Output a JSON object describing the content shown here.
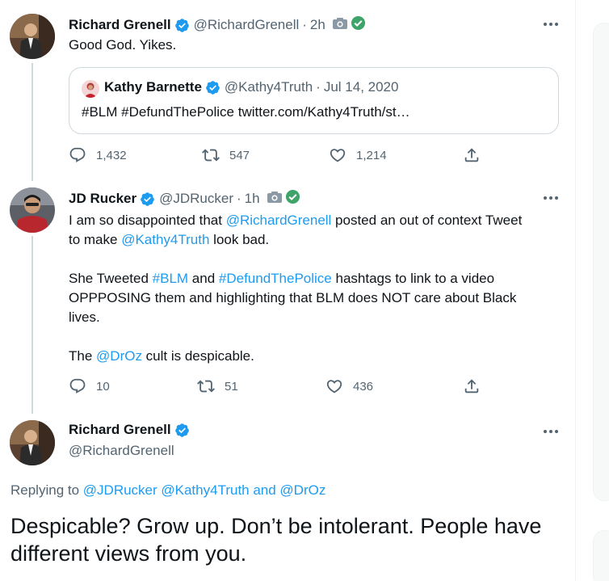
{
  "tweets": [
    {
      "name": "Richard Grenell",
      "handle": "@RichardGrenell",
      "separator": "·",
      "time": "2h",
      "text": "Good God. Yikes.",
      "quote": {
        "name": "Kathy Barnette",
        "handle": "@Kathy4Truth",
        "separator": "·",
        "date": "Jul 14, 2020",
        "text": "#BLM #DefundThePolice twitter.com/Kathy4Truth/st…"
      },
      "stats": {
        "replies": "1,432",
        "retweets": "547",
        "likes": "1,214"
      }
    },
    {
      "name": "JD Rucker",
      "handle": "@JDRucker",
      "separator": "·",
      "time": "1h",
      "p1": {
        "a": "I am so disappointed that ",
        "m1": "@RichardGrenell",
        "b": " posted an out of context Tweet",
        "c": "to make ",
        "m2": "@Kathy4Truth",
        "d": " look bad."
      },
      "p2": {
        "a": "She Tweeted ",
        "h1": "#BLM",
        "b": " and ",
        "h2": "#DefundThePolice",
        "c": " hashtags to link to a video",
        "l2": "OPPPOSING them and highlighting that BLM does NOT care about Black",
        "l3": "lives."
      },
      "p3": {
        "a": "The ",
        "m": "@DrOz",
        "b": " cult is despicable."
      },
      "stats": {
        "replies": "10",
        "retweets": "51",
        "likes": "436"
      }
    }
  ],
  "focused": {
    "name": "Richard Grenell",
    "handle": "@RichardGrenell",
    "replying_prefix": "Replying to ",
    "replying_to": "@JDRucker @Kathy4Truth and @DrOz",
    "text": "Despicable? Grow up. Don’t be intolerant. People have different views from you."
  },
  "colors": {
    "accent": "#1d9bf0",
    "muted": "#536471",
    "text": "#0f1419",
    "verified": "#1d9bf0",
    "media_badge": "#00ba7c"
  }
}
